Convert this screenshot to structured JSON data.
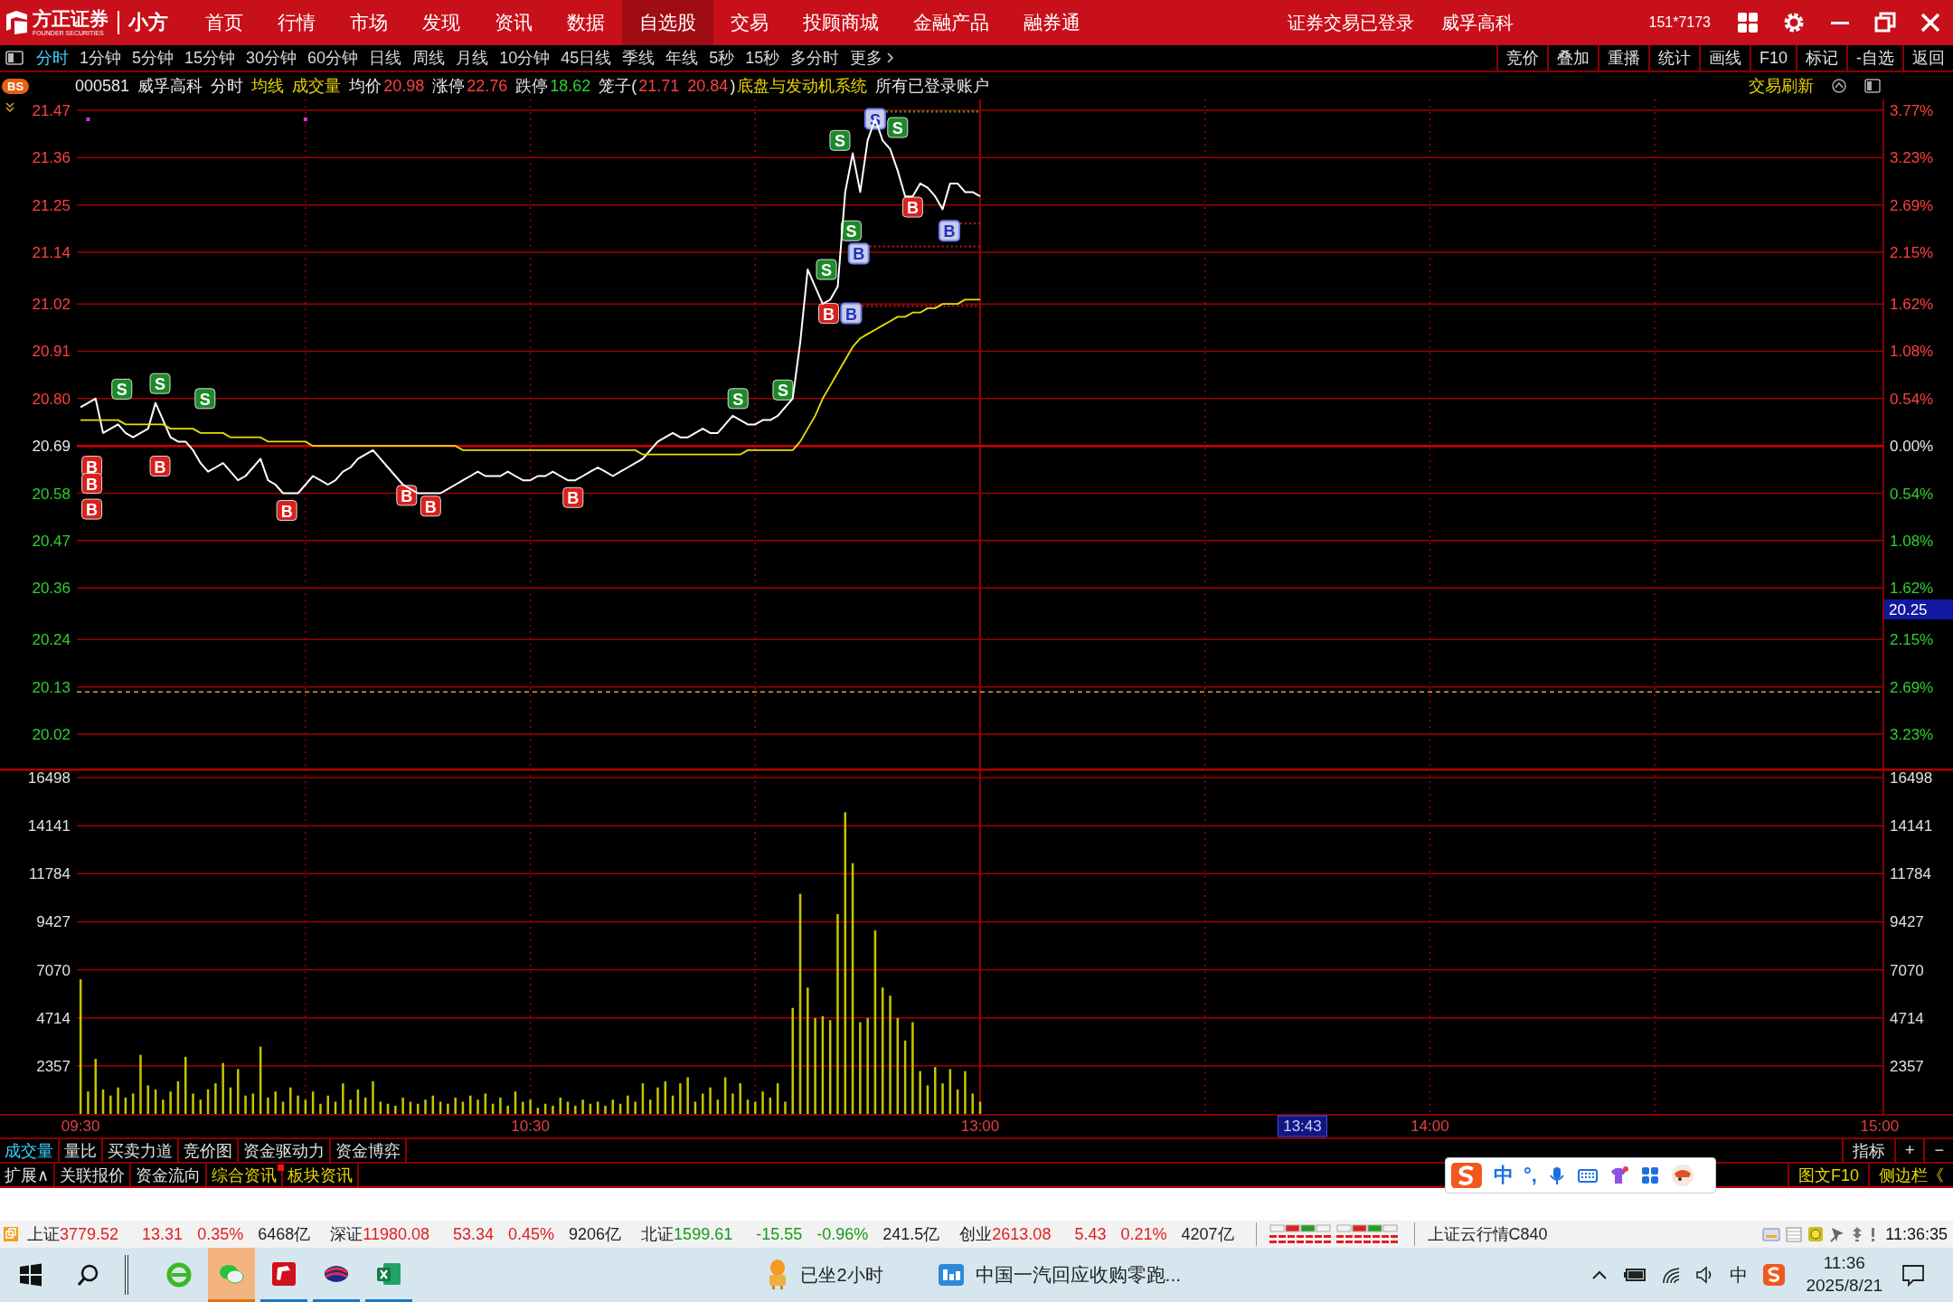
{
  "title_bar": {
    "logo_text": "方正证券",
    "logo_subtext": "FOUNDER SECURITIES",
    "app_name": "小方",
    "nav": [
      {
        "label": "首页",
        "selected": false
      },
      {
        "label": "行情",
        "selected": false
      },
      {
        "label": "市场",
        "selected": false
      },
      {
        "label": "发现",
        "selected": false
      },
      {
        "label": "资讯",
        "selected": false
      },
      {
        "label": "数据",
        "selected": false
      },
      {
        "label": "自选股",
        "selected": true
      },
      {
        "label": "交易",
        "selected": false
      },
      {
        "label": "投顾商城",
        "selected": false
      },
      {
        "label": "金融产品",
        "selected": false
      },
      {
        "label": "融券通",
        "selected": false
      }
    ],
    "login_status": "证券交易已登录",
    "stock_name": "威孚高科",
    "account": "151*7173"
  },
  "period_bar": {
    "periods": [
      {
        "label": "分时",
        "selected": true
      },
      {
        "label": "1分钟",
        "selected": false
      },
      {
        "label": "5分钟",
        "selected": false
      },
      {
        "label": "15分钟",
        "selected": false
      },
      {
        "label": "30分钟",
        "selected": false
      },
      {
        "label": "60分钟",
        "selected": false
      },
      {
        "label": "日线",
        "selected": false
      },
      {
        "label": "周线",
        "selected": false
      },
      {
        "label": "月线",
        "selected": false
      },
      {
        "label": "10分钟",
        "selected": false
      },
      {
        "label": "45日线",
        "selected": false
      },
      {
        "label": "季线",
        "selected": false
      },
      {
        "label": "年线",
        "selected": false
      },
      {
        "label": "5秒",
        "selected": false
      },
      {
        "label": "15秒",
        "selected": false
      },
      {
        "label": "多分时",
        "selected": false
      }
    ],
    "more": "更多",
    "tools": [
      "竞价",
      "叠加",
      "重播",
      "统计",
      "画线",
      "F10",
      "标记",
      "-自选",
      "返回"
    ]
  },
  "info_bar": {
    "badge": "BS",
    "code": "000581",
    "name": "威孚高科",
    "mode": "分时",
    "avg_line": "均线",
    "volume": "成交量",
    "avg_price_label": "均价",
    "avg_price": "20.98",
    "limit_up_label": "涨停",
    "limit_up": "22.76",
    "limit_down_label": "跌停",
    "limit_down": "18.62",
    "cage_label": "笼子(",
    "cage_high": "21.71",
    "cage_low": "20.84",
    "cage_end": ")",
    "sector": "底盘与发动机系统",
    "accounts": "所有已登录账户",
    "refresh": "交易刷新"
  },
  "price_chart": {
    "chart_data": {
      "type": "line",
      "grid": true,
      "ylim": [
        20.02,
        21.47
      ],
      "yticks": [
        {
          "value": 21.47,
          "label": "21.47"
        },
        {
          "value": 21.36,
          "label": "21.36"
        },
        {
          "value": 21.25,
          "label": "21.25"
        },
        {
          "value": 21.14,
          "label": "21.14"
        },
        {
          "value": 21.02,
          "label": "21.02"
        },
        {
          "value": 20.91,
          "label": "20.91"
        },
        {
          "value": 20.8,
          "label": "20.80"
        },
        {
          "value": 20.69,
          "label": "20.69"
        },
        {
          "value": 20.58,
          "label": "20.58"
        },
        {
          "value": 20.47,
          "label": "20.47"
        },
        {
          "value": 20.36,
          "label": "20.36"
        },
        {
          "value": 20.24,
          "label": "20.24"
        },
        {
          "value": 20.13,
          "label": "20.13"
        },
        {
          "value": 20.02,
          "label": "20.02"
        }
      ],
      "ref_lines": [
        {
          "axis": "y",
          "value": 20.69,
          "color": "#d00000"
        },
        {
          "axis": "y",
          "value": 20.118,
          "color": "#e0a030"
        }
      ],
      "categories": [
        null,
        null,
        null,
        null,
        null,
        null,
        null,
        null,
        null,
        null,
        null,
        null,
        null,
        null,
        null,
        null,
        null,
        null,
        null,
        null,
        null,
        null,
        null,
        null,
        null,
        null,
        null,
        null,
        null,
        null,
        null,
        null,
        null,
        null,
        null,
        null,
        null,
        null,
        null,
        null,
        null,
        null,
        null,
        null,
        null,
        null,
        null,
        null,
        null,
        null,
        null,
        null,
        null,
        null,
        null,
        null,
        null,
        null,
        null,
        null,
        null,
        null,
        null,
        null,
        null,
        null,
        null,
        null,
        null,
        null,
        null,
        null,
        null,
        null,
        null,
        null,
        null,
        null,
        null,
        null,
        null,
        null,
        null,
        null,
        null,
        null,
        null,
        null,
        null,
        null,
        null,
        null,
        null,
        null,
        null,
        null,
        null,
        null,
        null,
        null,
        null,
        null,
        null,
        null,
        null,
        null,
        null,
        null,
        null,
        null,
        null,
        null,
        null,
        null,
        null,
        null,
        null,
        null,
        null,
        null,
        null,
        null,
        null,
        null,
        null,
        null,
        null,
        null,
        null,
        null,
        null,
        null,
        null,
        null,
        null,
        null,
        null,
        null,
        null,
        null,
        null,
        null,
        null,
        null,
        null,
        null,
        null,
        null,
        null,
        null,
        null,
        null,
        null,
        null,
        null,
        null,
        null,
        null,
        null,
        null,
        null,
        null,
        null,
        null,
        null,
        null,
        null,
        null,
        null,
        null,
        null,
        null,
        null,
        null,
        null,
        null,
        null,
        null,
        null,
        null,
        null,
        null,
        null,
        null,
        null,
        null,
        null,
        null,
        null,
        null,
        null,
        null,
        null,
        null,
        null,
        null,
        null,
        null,
        null,
        null,
        null,
        null,
        null,
        null,
        null,
        null,
        null,
        null,
        null,
        null,
        null,
        null,
        null,
        null,
        null,
        null,
        null,
        null,
        null,
        null,
        null,
        null,
        null,
        null,
        null,
        null,
        null,
        null,
        null,
        null,
        null,
        null,
        null,
        null,
        null,
        null,
        null,
        null,
        null,
        null,
        null
      ],
      "series": [
        {
          "color": "#ffffff",
          "values": [
            20.78,
            20.79,
            20.8,
            20.72,
            20.73,
            20.74,
            20.72,
            20.71,
            20.72,
            20.73,
            20.79,
            20.75,
            20.71,
            20.7,
            20.7,
            20.68,
            20.65,
            20.63,
            20.64,
            20.65,
            20.63,
            20.61,
            20.62,
            20.64,
            20.66,
            20.61,
            20.6,
            20.58,
            20.58,
            20.58,
            20.6,
            20.62,
            20.61,
            20.6,
            20.61,
            20.63,
            20.64,
            20.66,
            20.67,
            20.68,
            20.66,
            20.64,
            20.62,
            20.6,
            20.59,
            20.58,
            20.58,
            20.58,
            20.58,
            20.59,
            20.6,
            20.61,
            20.62,
            20.63,
            20.62,
            20.62,
            20.62,
            20.63,
            20.62,
            20.61,
            20.61,
            20.62,
            20.62,
            20.63,
            20.62,
            20.61,
            20.61,
            20.62,
            20.63,
            20.64,
            20.63,
            20.62,
            20.63,
            20.64,
            20.65,
            20.66,
            20.68,
            20.7,
            20.71,
            20.72,
            20.71,
            20.71,
            20.72,
            20.73,
            20.72,
            20.72,
            20.74,
            20.76,
            20.75,
            20.74,
            20.74,
            20.75,
            20.75,
            20.76,
            20.78,
            20.8,
            20.93,
            21.1,
            21.06,
            21.02,
            21.03,
            21.06,
            21.28,
            21.37,
            21.28,
            21.4,
            21.45,
            21.4,
            21.38,
            21.33,
            21.27,
            21.27,
            21.3,
            21.29,
            21.27,
            21.24,
            21.3,
            21.3,
            21.28,
            21.28,
            21.27,
            null,
            null,
            null,
            null,
            null,
            null,
            null,
            null,
            null,
            null,
            null,
            null,
            null,
            null,
            null,
            null,
            null,
            null,
            null,
            null,
            null,
            null,
            null,
            null,
            null,
            null,
            null,
            null,
            null,
            null,
            null,
            null,
            null,
            null,
            null,
            null,
            null,
            null,
            null,
            null,
            null,
            null,
            null,
            null,
            null,
            null,
            null,
            null,
            null,
            null,
            null,
            null,
            null,
            null,
            null,
            null,
            null,
            null,
            null,
            null,
            null,
            null,
            null,
            null,
            null,
            null,
            null,
            null,
            null,
            null,
            null,
            null,
            null,
            null,
            null,
            null,
            null,
            null,
            null,
            null,
            null,
            null,
            null,
            null,
            null,
            null,
            null,
            null,
            null,
            null,
            null,
            null,
            null,
            null,
            null,
            null,
            null,
            null,
            null,
            null,
            null,
            null,
            null,
            null,
            null,
            null,
            null,
            null,
            null,
            null,
            null,
            null,
            null,
            null,
            null,
            null,
            null,
            null,
            null,
            null
          ]
        },
        {
          "color": "#e8e000",
          "values": [
            20.75,
            20.75,
            20.75,
            20.75,
            20.75,
            20.75,
            20.74,
            20.74,
            20.74,
            20.74,
            20.74,
            20.74,
            20.73,
            20.73,
            20.73,
            20.73,
            20.72,
            20.72,
            20.72,
            20.72,
            20.71,
            20.71,
            20.71,
            20.71,
            20.71,
            20.7,
            20.7,
            20.7,
            20.7,
            20.7,
            20.7,
            20.69,
            20.69,
            20.69,
            20.69,
            20.69,
            20.69,
            20.69,
            20.69,
            20.69,
            20.69,
            20.69,
            20.69,
            20.69,
            20.69,
            20.69,
            20.69,
            20.69,
            20.69,
            20.69,
            20.69,
            20.68,
            20.68,
            20.68,
            20.68,
            20.68,
            20.68,
            20.68,
            20.68,
            20.68,
            20.68,
            20.68,
            20.68,
            20.68,
            20.68,
            20.68,
            20.68,
            20.68,
            20.68,
            20.68,
            20.68,
            20.68,
            20.68,
            20.68,
            20.68,
            20.67,
            20.67,
            20.67,
            20.67,
            20.67,
            20.67,
            20.67,
            20.67,
            20.67,
            20.67,
            20.67,
            20.67,
            20.67,
            20.67,
            20.68,
            20.68,
            20.68,
            20.68,
            20.68,
            20.68,
            20.68,
            20.7,
            20.73,
            20.76,
            20.8,
            20.83,
            20.86,
            20.89,
            20.92,
            20.94,
            20.95,
            20.96,
            20.97,
            20.98,
            20.99,
            20.99,
            21.0,
            21.0,
            21.01,
            21.01,
            21.02,
            21.02,
            21.02,
            21.03,
            21.03,
            21.03,
            null,
            null,
            null,
            null,
            null,
            null,
            null,
            null,
            null,
            null,
            null,
            null,
            null,
            null,
            null,
            null,
            null,
            null,
            null,
            null,
            null,
            null,
            null,
            null,
            null,
            null,
            null,
            null,
            null,
            null,
            null,
            null,
            null,
            null,
            null,
            null,
            null,
            null,
            null,
            null,
            null,
            null,
            null,
            null,
            null,
            null,
            null,
            null,
            null,
            null,
            null,
            null,
            null,
            null,
            null,
            null,
            null,
            null,
            null,
            null,
            null,
            null,
            null,
            null,
            null,
            null,
            null,
            null,
            null,
            null,
            null,
            null,
            null,
            null,
            null,
            null,
            null,
            null,
            null,
            null,
            null,
            null,
            null,
            null,
            null,
            null,
            null,
            null,
            null,
            null,
            null,
            null,
            null,
            null,
            null,
            null,
            null,
            null,
            null,
            null,
            null,
            null,
            null,
            null,
            null,
            null,
            null,
            null,
            null,
            null,
            null,
            null,
            null,
            null,
            null,
            null,
            null,
            null,
            null,
            null
          ]
        }
      ],
      "annotations": [
        {
          "y": 20.822,
          "text": "S"
        },
        {
          "y": 20.835,
          "text": "S"
        },
        {
          "y": 20.8,
          "text": "S"
        },
        {
          "y": 20.643,
          "text": "B"
        },
        {
          "y": 20.603,
          "text": "B"
        },
        {
          "y": 20.543,
          "text": "B"
        },
        {
          "y": 20.643,
          "text": "B"
        },
        {
          "y": 20.54,
          "text": "B"
        },
        {
          "y": 20.575,
          "text": "B"
        },
        {
          "y": 20.55,
          "text": "B"
        },
        {
          "y": 20.57,
          "text": "B"
        },
        {
          "y": 20.8,
          "text": "S"
        },
        {
          "y": 20.82,
          "text": "S"
        },
        {
          "y": 21.1,
          "text": "S"
        },
        {
          "y": 20.998,
          "text": "B"
        },
        {
          "y": 20.998,
          "text": "B"
        },
        {
          "y": 21.137,
          "text": "B"
        },
        {
          "y": 21.19,
          "text": "S"
        },
        {
          "y": 21.4,
          "text": "S"
        },
        {
          "y": 21.45,
          "text": "S"
        },
        {
          "y": 21.43,
          "text": "S"
        },
        {
          "y": 21.245,
          "text": "B"
        },
        {
          "y": 21.19,
          "text": "B"
        }
      ]
    },
    "percent_labels": [
      "3.77%",
      "3.23%",
      "2.69%",
      "2.15%",
      "1.62%",
      "1.08%",
      "0.54%",
      "0.00%",
      "0.54%",
      "1.08%",
      "1.62%",
      "2.15%",
      "2.69%",
      "3.23%"
    ],
    "trade_marks": [
      {
        "kind": "sell",
        "color": "#1d8a2a",
        "pending": false
      },
      {
        "kind": "sell",
        "color": "#1d8a2a",
        "pending": false
      },
      {
        "kind": "sell",
        "color": "#1d8a2a",
        "pending": false
      },
      {
        "kind": "buy",
        "color": "#d9201c",
        "pending": false
      },
      {
        "kind": "buy",
        "color": "#d9201c",
        "pending": false
      },
      {
        "kind": "buy",
        "color": "#d9201c",
        "pending": false
      },
      {
        "kind": "buy",
        "color": "#d9201c",
        "pending": false
      },
      {
        "kind": "buy",
        "color": "#d9201c",
        "pending": false
      },
      {
        "kind": "buy",
        "color": "#d9201c",
        "pending": false
      },
      {
        "kind": "buy",
        "color": "#d9201c",
        "pending": false
      },
      {
        "kind": "buy",
        "color": "#d9201c",
        "pending": false
      },
      {
        "kind": "sell",
        "color": "#1d8a2a",
        "pending": false
      },
      {
        "kind": "sell",
        "color": "#1d8a2a",
        "pending": false
      },
      {
        "kind": "sell",
        "color": "#1d8a2a",
        "pending": false
      },
      {
        "kind": "buy",
        "color": "#d9201c",
        "pending": false
      },
      {
        "kind": "buy",
        "color": "#c9cde4",
        "pending": true
      },
      {
        "kind": "buy",
        "color": "#c9cde4",
        "pending": true
      },
      {
        "kind": "sell",
        "color": "#1d8a2a",
        "pending": false
      },
      {
        "kind": "sell",
        "color": "#1d8a2a",
        "pending": false
      },
      {
        "kind": "sell",
        "color": "#c9cde4",
        "pending": true
      },
      {
        "kind": "sell",
        "color": "#1d8a2a",
        "pending": false
      },
      {
        "kind": "buy",
        "color": "#d9201c",
        "pending": false
      },
      {
        "kind": "buy",
        "color": "#c9cde4",
        "pending": true
      }
    ],
    "dots": [
      {
        "color": "#e030e0"
      },
      {
        "color": "#e030e0"
      }
    ],
    "cursor_price": "20.25"
  },
  "volume_chart": {
    "chart_data": {
      "type": "bar",
      "grid": true,
      "ylim": [
        0,
        16498
      ],
      "yticks": [
        {
          "value": 16498,
          "label": "16498"
        },
        {
          "value": 14141,
          "label": "14141"
        },
        {
          "value": 11784,
          "label": "11784"
        },
        {
          "value": 9427,
          "label": "9427"
        },
        {
          "value": 7070,
          "label": "7070"
        },
        {
          "value": 4714,
          "label": "4714"
        },
        {
          "value": 2357,
          "label": "2357"
        }
      ],
      "categories": [
        "09:30",
        null,
        null,
        null,
        null,
        null,
        null,
        null,
        null,
        null,
        null,
        null,
        null,
        null,
        null,
        null,
        null,
        null,
        null,
        null,
        null,
        null,
        null,
        null,
        null,
        null,
        null,
        null,
        null,
        null,
        null,
        null,
        null,
        null,
        null,
        null,
        null,
        null,
        null,
        null,
        null,
        null,
        null,
        null,
        null,
        null,
        null,
        null,
        null,
        null,
        null,
        null,
        null,
        null,
        null,
        null,
        null,
        null,
        null,
        null,
        "10:30",
        null,
        null,
        null,
        null,
        null,
        null,
        null,
        null,
        null,
        null,
        null,
        null,
        null,
        null,
        null,
        null,
        null,
        null,
        null,
        null,
        null,
        null,
        null,
        null,
        null,
        null,
        null,
        null,
        null,
        null,
        null,
        null,
        null,
        null,
        null,
        null,
        null,
        null,
        null,
        null,
        null,
        null,
        null,
        null,
        null,
        null,
        null,
        null,
        null,
        null,
        null,
        null,
        null,
        null,
        null,
        null,
        null,
        null,
        null,
        "13:00",
        null,
        null,
        null,
        null,
        null,
        null,
        null,
        null,
        null,
        null,
        null,
        null,
        null,
        null,
        null,
        null,
        null,
        null,
        null,
        null,
        null,
        null,
        null,
        null,
        null,
        null,
        null,
        null,
        null,
        null,
        null,
        null,
        null,
        null,
        null,
        null,
        null,
        null,
        null,
        null,
        null,
        null,
        null,
        null,
        null,
        null,
        null,
        null,
        null,
        null,
        null,
        null,
        null,
        null,
        null,
        null,
        null,
        null,
        null,
        "14:00",
        null,
        null,
        null,
        null,
        null,
        null,
        null,
        null,
        null,
        null,
        null,
        null,
        null,
        null,
        null,
        null,
        null,
        null,
        null,
        null,
        null,
        null,
        null,
        null,
        null,
        null,
        null,
        null,
        null,
        null,
        null,
        null,
        null,
        null,
        null,
        null,
        null,
        null,
        null,
        null,
        null,
        null,
        null,
        null,
        null,
        null,
        null,
        null,
        null,
        null,
        null,
        null,
        null,
        null,
        null,
        null,
        null,
        null,
        null,
        "15:00"
      ],
      "series": [
        {
          "color": "#c8c400",
          "values": [
            6600,
            1100,
            2700,
            1200,
            900,
            1300,
            800,
            1000,
            2900,
            1400,
            1200,
            700,
            1100,
            1600,
            2800,
            1000,
            700,
            1200,
            1500,
            2500,
            1300,
            2200,
            900,
            1000,
            3300,
            800,
            1100,
            600,
            1300,
            900,
            700,
            1100,
            500,
            900,
            600,
            1500,
            700,
            1200,
            800,
            1600,
            600,
            500,
            400,
            800,
            600,
            500,
            700,
            900,
            600,
            500,
            800,
            600,
            900,
            700,
            1000,
            500,
            800,
            400,
            1100,
            600,
            700,
            300,
            500,
            400,
            800,
            600,
            400,
            700,
            500,
            600,
            400,
            700,
            500,
            900,
            600,
            1500,
            700,
            1300,
            1600,
            900,
            1500,
            1800,
            600,
            1000,
            1300,
            700,
            1800,
            1000,
            1500,
            700,
            600,
            1100,
            800,
            1500,
            600,
            5200,
            10800,
            6200,
            4700,
            4800,
            4600,
            9800,
            14800,
            12300,
            4500,
            4700,
            9000,
            6200,
            5800,
            4700,
            3600,
            4500,
            2100,
            1400,
            2300,
            1500,
            2200,
            1200,
            2100,
            1000,
            600,
            null,
            null,
            null,
            null,
            null,
            null,
            null,
            null,
            null,
            null,
            null,
            null,
            null,
            null,
            null,
            null,
            null,
            null,
            null,
            null,
            null,
            null,
            null,
            null,
            null,
            null,
            null,
            null,
            null,
            null,
            null,
            null,
            null,
            null,
            null,
            null,
            null,
            null,
            null,
            null,
            null,
            null,
            null,
            null,
            null,
            null,
            null,
            null,
            null,
            null,
            null,
            null,
            null,
            null,
            null,
            null,
            null,
            null,
            null,
            null,
            null,
            null,
            null,
            null,
            null,
            null,
            null,
            null,
            null,
            null,
            null,
            null,
            null,
            null,
            null,
            null,
            null,
            null,
            null,
            null,
            null,
            null,
            null,
            null,
            null,
            null,
            null,
            null,
            null,
            null,
            null,
            null,
            null,
            null,
            null,
            null,
            null,
            null,
            null,
            null,
            null,
            null,
            null,
            null,
            null,
            null,
            null,
            null,
            null,
            null,
            null,
            null,
            null,
            null,
            null,
            null,
            null,
            null,
            null,
            null
          ]
        }
      ]
    },
    "right_labels": [
      "16498",
      "14141",
      "11784",
      "9427",
      "7070",
      "4714",
      "2357"
    ],
    "cursor_time": "13:43"
  },
  "indicator_tabs": {
    "tabs": [
      {
        "label": "成交量",
        "selected": true
      },
      {
        "label": "量比",
        "selected": false
      },
      {
        "label": "买卖力道",
        "selected": false
      },
      {
        "label": "竞价图",
        "selected": false
      },
      {
        "label": "资金驱动力",
        "selected": false
      },
      {
        "label": "资金博弈",
        "selected": false
      }
    ],
    "right": [
      "指标",
      "+",
      "−"
    ]
  },
  "info_tabs": {
    "tabs": [
      {
        "label": "扩展∧",
        "highlighted": false,
        "badge": false
      },
      {
        "label": "关联报价",
        "highlighted": false,
        "badge": false
      },
      {
        "label": "资金流向",
        "highlighted": false,
        "badge": false
      },
      {
        "label": "综合资讯",
        "highlighted": true,
        "badge": true
      },
      {
        "label": "板块资讯",
        "highlighted": true,
        "badge": false
      }
    ],
    "right": [
      "图文F10",
      "侧边栏《"
    ]
  },
  "ime_toolbar": {
    "mode": "中",
    "punct": "°,"
  },
  "status_bar": {
    "indices": [
      {
        "name": "上证",
        "value": "3779.52",
        "change": "13.31",
        "percent": "0.35%",
        "amount": "6468亿",
        "color": "#e02020"
      },
      {
        "name": "深证",
        "value": "11980.08",
        "change": "53.34",
        "percent": "0.45%",
        "amount": "9206亿",
        "color": "#e02020"
      },
      {
        "name": "北证",
        "value": "1599.61",
        "change": "-15.55",
        "percent": "-0.96%",
        "amount": "241.5亿",
        "color": "#179a17"
      },
      {
        "name": "创业",
        "value": "2613.08",
        "change": "5.43",
        "percent": "0.21%",
        "amount": "4207亿",
        "color": "#e02020"
      }
    ],
    "server": "上证云行情C840",
    "time": "11:36:35"
  },
  "taskbar": {
    "apps": [
      {
        "kind": "browser",
        "open": false,
        "active": false
      },
      {
        "kind": "chat",
        "open": true,
        "active": true
      },
      {
        "kind": "trading",
        "open": true,
        "active": false
      },
      {
        "kind": "globe",
        "open": true,
        "active": false
      },
      {
        "kind": "spreadsheet",
        "open": true,
        "active": false
      }
    ],
    "reminder": "已坐2小时",
    "news": "中国一汽回应收购零跑...",
    "input_lang": "中",
    "clock_time": "11:36",
    "clock_date": "2025/8/21"
  }
}
